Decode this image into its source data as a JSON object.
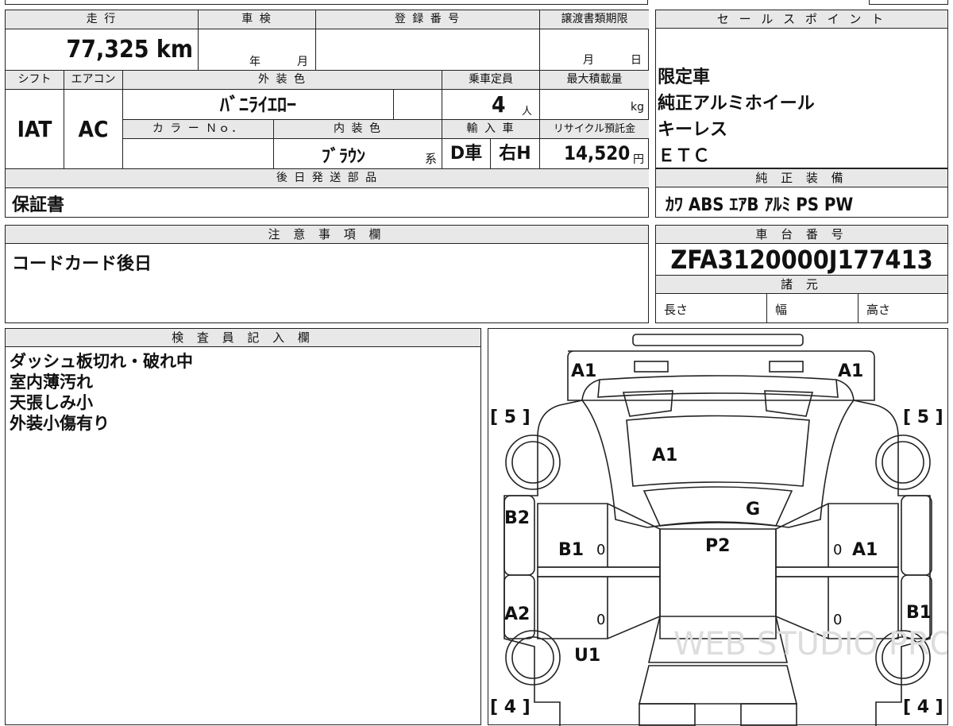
{
  "top_table": {
    "mileage_label": "走 行",
    "mileage_value": "77,325 km",
    "inspection_label": "車 検",
    "inspection_year_unit": "年",
    "inspection_month_unit": "月",
    "registration_label": "登 録 番 号",
    "transfer_deadline_label": "譲渡書類期限",
    "transfer_month_unit": "月",
    "transfer_day_unit": "日",
    "shift_label": "シフト",
    "shift_value": "IAT",
    "aircon_label": "エアコン",
    "aircon_value": "AC",
    "exterior_color_label": "外 装 色",
    "exterior_color_value": "ﾊﾞﾆﾗｲｴﾛｰ",
    "capacity_label": "乗車定員",
    "capacity_value": "4",
    "capacity_unit": "人",
    "max_load_label": "最大積載量",
    "max_load_unit": "kg",
    "color_no_label": "カ ラ ー Ｎｏ．",
    "interior_color_label": "内 装 色",
    "interior_color_value": "ﾌﾞﾗｳﾝ",
    "interior_color_suffix": "系",
    "import_label": "輸 入 車",
    "import_value": "D車",
    "handle_value": "右H",
    "recycle_label": "リサイクル預託金",
    "recycle_value": "14,520",
    "recycle_unit": "円",
    "later_parts_label": "後 日 発 送 部 品",
    "later_parts_value": "保証書"
  },
  "sales_points": {
    "label": "セ ー ル ス ポ イ ン ト",
    "items": [
      "限定車",
      "純正アルミホイール",
      "キーレス",
      "ＥＴＣ"
    ]
  },
  "genuine_equipment": {
    "label": "純 正 装 備",
    "value": "ｶﾜ ABS ｴｱB ｱﾙﾐ PS PW"
  },
  "notes": {
    "label": "注 意 事 項 欄",
    "value": "コードカード後日"
  },
  "chassis": {
    "label": "車 台 番 号",
    "value": "ZFA3120000J177413",
    "specs_label": "諸 元",
    "length_label": "長さ",
    "width_label": "幅",
    "height_label": "高さ"
  },
  "inspector": {
    "label": "検 査 員 記 入 欄",
    "lines": [
      "ダッシュ板切れ・破れ中",
      "室内薄汚れ",
      "天張しみ小",
      "外装小傷有り"
    ]
  },
  "diagram": {
    "marks": {
      "front_left": "A1",
      "front_right": "A1",
      "bracket_tl": "[ 5 ]",
      "bracket_tr": "[ 5 ]",
      "bracket_bl": "[ 4 ]",
      "bracket_br": "[ 4 ]",
      "hood": "A1",
      "windshield": "G",
      "roof": "P2",
      "left_front_pillar": "B2",
      "left_front_door": "B1",
      "left_front_door_zero": "0",
      "left_rear_pillar": "A2",
      "left_rear_door_zero": "0",
      "left_rear": "U1",
      "right_front_door": "A1",
      "right_front_door_zero": "0",
      "right_rear_door_zero": "0",
      "right_rear_pillar": "B1"
    },
    "watermark": "WEB STUDIO PRO"
  }
}
